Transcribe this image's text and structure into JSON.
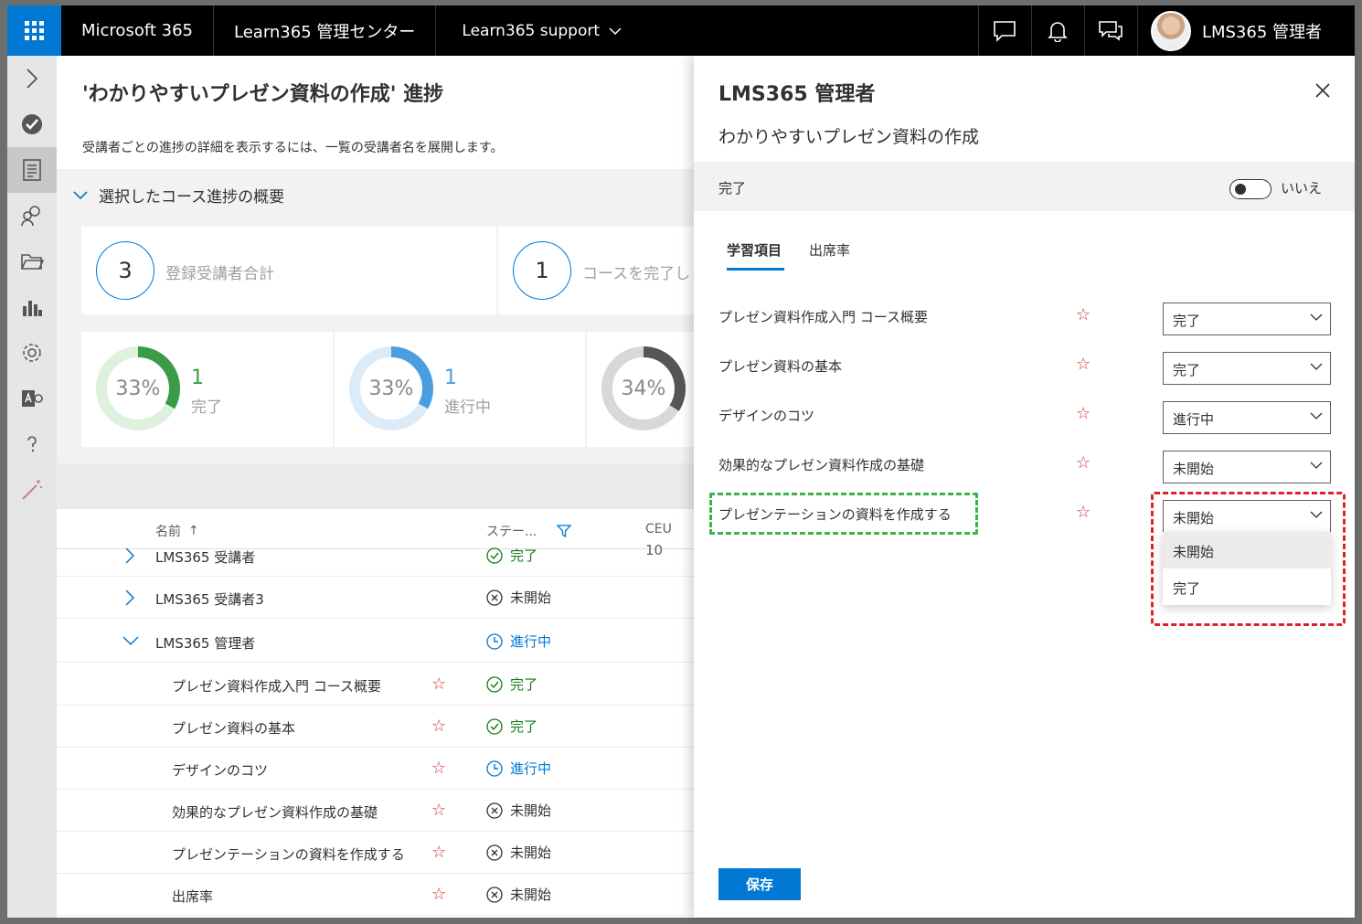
{
  "topbar": {
    "product": "Microsoft 365",
    "app": "Learn365 管理センター",
    "site": "Learn365 support",
    "user_name": "LMS365 管理者"
  },
  "main": {
    "title": "'わかりやすいプレゼン資料の作成' 進捗",
    "description": "受講者ごとの進捗の詳細を表示するには、一覧の受講者名を展開します。",
    "summary_heading": "選択したコース進捗の概要",
    "counts": [
      {
        "value": "3",
        "label": "登録受講者合計"
      },
      {
        "value": "1",
        "label": "コースを完了し"
      }
    ],
    "donuts": [
      {
        "pct_label": "33%",
        "pct": 33,
        "count": "1",
        "label": "完了",
        "color": "#3c9b48",
        "track": "#dff0df"
      },
      {
        "pct_label": "33%",
        "pct": 33,
        "count": "1",
        "label": "進行中",
        "color": "#4a9ee0",
        "track": "#dcebf8"
      },
      {
        "pct_label": "34%",
        "pct": 34,
        "count": "",
        "label": "",
        "color": "#555555",
        "track": "#d8d8d8"
      }
    ],
    "columns": {
      "name": "名前",
      "sort_indicator": "↑",
      "status": "ステー...",
      "ceu": "CEU"
    },
    "rows": [
      {
        "name": "LMS365 受講者",
        "status": "完了",
        "status_type": "done",
        "ceu": "10",
        "expand": "collapsed"
      },
      {
        "name": "LMS365 受講者3",
        "status": "未開始",
        "status_type": "not",
        "ceu": "",
        "expand": "collapsed"
      },
      {
        "name": "LMS365 管理者",
        "status": "進行中",
        "status_type": "prog",
        "ceu": "",
        "expand": "expanded"
      },
      {
        "name": "プレゼン資料作成入門 コース概要",
        "status": "完了",
        "status_type": "done",
        "child": true
      },
      {
        "name": "プレゼン資料の基本",
        "status": "完了",
        "status_type": "done",
        "child": true
      },
      {
        "name": "デザインのコツ",
        "status": "進行中",
        "status_type": "prog",
        "child": true
      },
      {
        "name": "効果的なプレゼン資料作成の基礎",
        "status": "未開始",
        "status_type": "not",
        "child": true
      },
      {
        "name": "プレゼンテーションの資料を作成する",
        "status": "未開始",
        "status_type": "not",
        "child": true
      },
      {
        "name": "出席率",
        "status": "未開始",
        "status_type": "not",
        "child": true
      }
    ]
  },
  "panel": {
    "title": "LMS365 管理者",
    "course": "わかりやすいプレゼン資料の作成",
    "complete_label": "完了",
    "toggle_value": "いいえ",
    "tabs": [
      "学習項目",
      "出席率"
    ],
    "items": [
      {
        "label": "プレゼン資料作成入門 コース概要",
        "value": "完了"
      },
      {
        "label": "プレゼン資料の基本",
        "value": "完了"
      },
      {
        "label": "デザインのコツ",
        "value": "進行中"
      },
      {
        "label": "効果的なプレゼン資料作成の基礎",
        "value": "未開始"
      },
      {
        "label": "プレゼンテーションの資料を作成する",
        "value": "未開始"
      }
    ],
    "dropdown_options": [
      "未開始",
      "完了"
    ],
    "save_label": "保存"
  }
}
